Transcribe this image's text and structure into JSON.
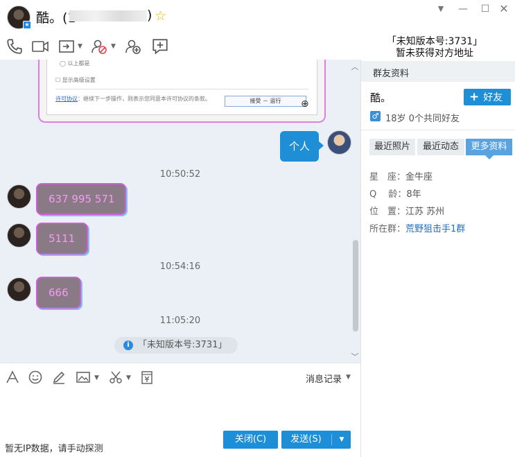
{
  "title": {
    "name": "酷。",
    "open_paren": "(1",
    "close_paren": ")",
    "star_icon": "star-icon"
  },
  "window_controls": {
    "menu": "▼",
    "minimize": "—",
    "maximize": "☐",
    "close": "✕"
  },
  "header_notice": {
    "line1": "「未知版本号:3731」",
    "line2": "暂未获得对方地址"
  },
  "screenshot_image": {
    "radio_text": "◯ 以上都是",
    "checkbox_text": "☐ 显示高级设置",
    "license_link": "许可协议",
    "license_text": "：继续下一步操作，则表示您同意本许可协议的条款。",
    "accept_button": "接受 － 运行"
  },
  "messages": {
    "me_bubble": "个人",
    "time1": "10:50:52",
    "msg1": "637 995 571",
    "msg2": "5111",
    "time2": "10:54:16",
    "msg3": "666",
    "time3": "11:05:20",
    "system_notice": "「未知版本号:3731」"
  },
  "input": {
    "history_label": "消息记录",
    "ip_status": "暂无IP数据，请手动探测",
    "close_button": "关闭(C)",
    "send_button": "发送(S)"
  },
  "right_panel": {
    "header": "群友资料",
    "name": "酷。",
    "add_friend": "好友",
    "age_friends": "18岁  0个共同好友",
    "tabs": [
      "最近照片",
      "最近动态",
      "更多资料"
    ],
    "constellation_label": "星　座：",
    "constellation_value": "金牛座",
    "q_age_label": "Q　 龄：",
    "q_age_value": "8年",
    "location_label": "位　置：",
    "location_value": "江苏 苏州",
    "group_label": "所在群：",
    "group_value": "荒野狙击手1群"
  },
  "colors": {
    "accent": "#1e8fd6",
    "chat_bg": "#eaf0f5",
    "bubble_border": "#d35cd8",
    "bubble_text": "#f39cf3"
  }
}
